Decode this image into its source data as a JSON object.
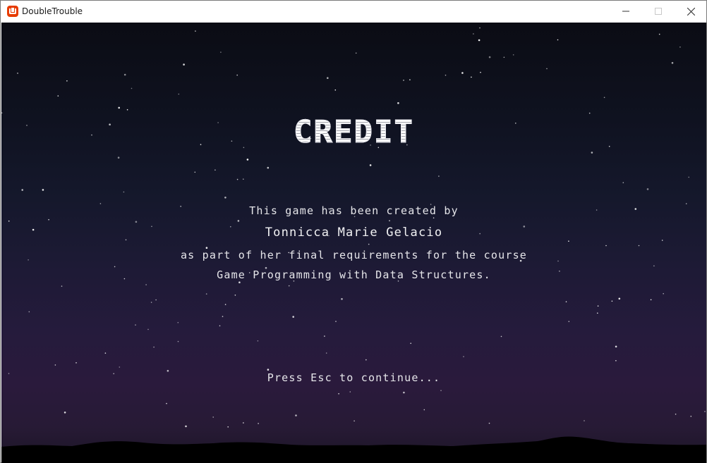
{
  "window": {
    "title": "DoubleTrouble",
    "icon": "monogame-icon",
    "controls": [
      "minimize-icon",
      "maximize-icon",
      "close-icon"
    ]
  },
  "screen": {
    "heading": "CREDIT",
    "lines": [
      "This game has been created by",
      "Tonnicca Marie Gelacio",
      "as part of her final requirements for the course",
      "Game Programming with Data Structures."
    ],
    "prompt": "Press Esc to continue..."
  },
  "colors": {
    "sky_top": "#0b0c14",
    "sky_bottom": "#2a1a3c",
    "text": "#e6e6ea",
    "icon_accent": "#e73c00"
  }
}
